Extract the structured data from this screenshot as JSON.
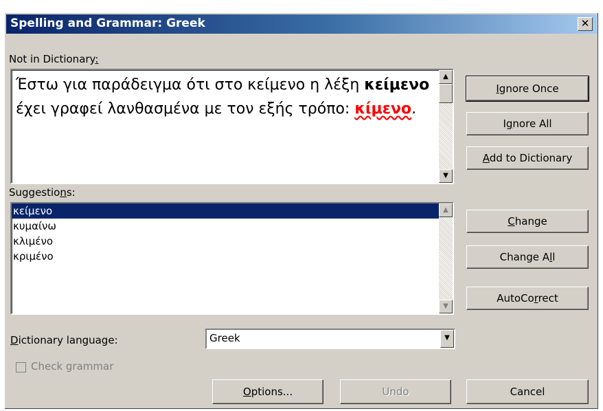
{
  "window": {
    "title": "Spelling and Grammar: Greek",
    "close_glyph": "✕"
  },
  "not_in_dictionary": {
    "label_pre": "Not in Dictionary",
    "label_accel": ":",
    "text_part1": "Έστω για παράδειγμα ότι στο κείμενο η λέξη ",
    "text_keyword": "κείμενο",
    "text_part2": " έχει γραφεί λανθασμένα με τον εξής τρόπο: ",
    "text_error": "κίμενο",
    "text_end": "."
  },
  "suggestions": {
    "label_pre": "Suggestio",
    "label_accel": "n",
    "label_post": "s:",
    "items": [
      "κείμενο",
      "κυμαίνω",
      "κλιμένο",
      "κριμένο"
    ],
    "selected_index": 0
  },
  "buttons": {
    "ignore_once_accel": "I",
    "ignore_once_rest": "gnore Once",
    "ignore_all_pre": "I",
    "ignore_all_accel": "g",
    "ignore_all_rest": "nore All",
    "add_dict_accel": "A",
    "add_dict_rest": "dd to Dictionary",
    "change_accel": "C",
    "change_rest": "hange",
    "change_all_pre": "Change A",
    "change_all_accel": "l",
    "change_all_rest": "l",
    "autocorrect_pre": "AutoCo",
    "autocorrect_accel": "r",
    "autocorrect_rest": "rect",
    "options_accel": "O",
    "options_rest": "ptions...",
    "undo_label": "Undo",
    "cancel_label": "Cancel"
  },
  "dictionary_language": {
    "label_accel": "D",
    "label_rest": "ictionary language:",
    "value": "Greek"
  },
  "check_grammar": {
    "label": "Check grammar",
    "checked": false,
    "enabled": false
  },
  "icons": {
    "scroll_up": "▲",
    "scroll_down": "▼",
    "dropdown": "▼"
  }
}
